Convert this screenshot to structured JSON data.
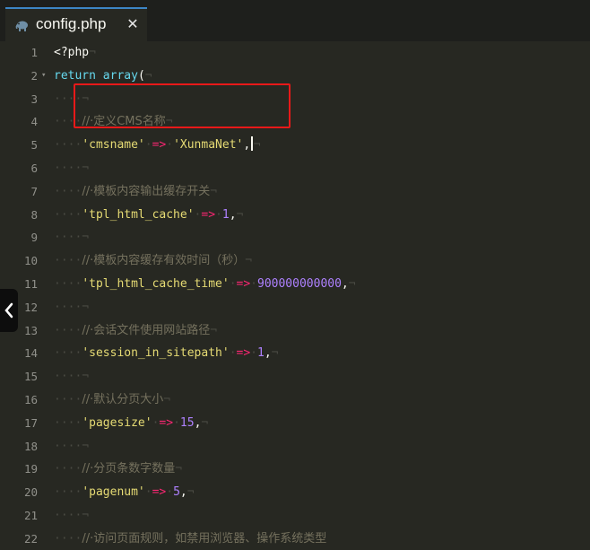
{
  "tab": {
    "title": "config.php",
    "close_glyph": "✕",
    "icon": "php-elephant-icon"
  },
  "editor": {
    "lines": [
      {
        "n": "1",
        "fold": "",
        "parts": [
          [
            "t",
            "<?php"
          ],
          [
            "ws",
            "¬"
          ]
        ]
      },
      {
        "n": "2",
        "fold": "▾",
        "parts": [
          [
            "kw",
            "return"
          ],
          [
            "t",
            " "
          ],
          [
            "kw",
            "array"
          ],
          [
            "t",
            "("
          ],
          [
            "ws",
            "¬"
          ]
        ]
      },
      {
        "n": "3",
        "fold": "",
        "parts": [
          [
            "ws",
            "····¬"
          ]
        ]
      },
      {
        "n": "4",
        "fold": "",
        "parts": [
          [
            "ws",
            "····"
          ],
          [
            "cm",
            "//·定义CMS名称"
          ],
          [
            "ws",
            "¬"
          ]
        ]
      },
      {
        "n": "5",
        "fold": "",
        "parts": [
          [
            "ws",
            "····"
          ],
          [
            "str",
            "'cmsname'"
          ],
          [
            "ws",
            "·"
          ],
          [
            "op",
            "=>"
          ],
          [
            "ws",
            "·"
          ],
          [
            "str",
            "'XunmaNet'"
          ],
          [
            "t",
            ","
          ],
          [
            "cursor",
            ""
          ],
          [
            "ws",
            "¬"
          ]
        ]
      },
      {
        "n": "6",
        "fold": "",
        "parts": [
          [
            "ws",
            "····¬"
          ]
        ]
      },
      {
        "n": "7",
        "fold": "",
        "parts": [
          [
            "ws",
            "····"
          ],
          [
            "cm",
            "//·模板内容输出缓存开关"
          ],
          [
            "ws",
            "¬"
          ]
        ]
      },
      {
        "n": "8",
        "fold": "",
        "parts": [
          [
            "ws",
            "····"
          ],
          [
            "str",
            "'tpl_html_cache'"
          ],
          [
            "ws",
            "·"
          ],
          [
            "op",
            "=>"
          ],
          [
            "ws",
            "·"
          ],
          [
            "num",
            "1"
          ],
          [
            "t",
            ","
          ],
          [
            "ws",
            "¬"
          ]
        ]
      },
      {
        "n": "9",
        "fold": "",
        "parts": [
          [
            "ws",
            "····¬"
          ]
        ]
      },
      {
        "n": "10",
        "fold": "",
        "parts": [
          [
            "ws",
            "····"
          ],
          [
            "cm",
            "//·模板内容缓存有效时间（秒）"
          ],
          [
            "ws",
            "¬"
          ]
        ]
      },
      {
        "n": "11",
        "fold": "",
        "parts": [
          [
            "ws",
            "····"
          ],
          [
            "str",
            "'tpl_html_cache_time'"
          ],
          [
            "ws",
            "·"
          ],
          [
            "op",
            "=>"
          ],
          [
            "ws",
            "·"
          ],
          [
            "num",
            "900000000000"
          ],
          [
            "t",
            ","
          ],
          [
            "ws",
            "¬"
          ]
        ]
      },
      {
        "n": "12",
        "fold": "",
        "parts": [
          [
            "ws",
            "····¬"
          ]
        ]
      },
      {
        "n": "13",
        "fold": "",
        "parts": [
          [
            "ws",
            "····"
          ],
          [
            "cm",
            "//·会话文件使用网站路径"
          ],
          [
            "ws",
            "¬"
          ]
        ]
      },
      {
        "n": "14",
        "fold": "",
        "parts": [
          [
            "ws",
            "····"
          ],
          [
            "str",
            "'session_in_sitepath'"
          ],
          [
            "ws",
            "·"
          ],
          [
            "op",
            "=>"
          ],
          [
            "ws",
            "·"
          ],
          [
            "num",
            "1"
          ],
          [
            "t",
            ","
          ],
          [
            "ws",
            "¬"
          ]
        ]
      },
      {
        "n": "15",
        "fold": "",
        "parts": [
          [
            "ws",
            "····¬"
          ]
        ]
      },
      {
        "n": "16",
        "fold": "",
        "parts": [
          [
            "ws",
            "····"
          ],
          [
            "cm",
            "//·默认分页大小"
          ],
          [
            "ws",
            "¬"
          ]
        ]
      },
      {
        "n": "17",
        "fold": "",
        "parts": [
          [
            "ws",
            "····"
          ],
          [
            "str",
            "'pagesize'"
          ],
          [
            "ws",
            "·"
          ],
          [
            "op",
            "=>"
          ],
          [
            "ws",
            "·"
          ],
          [
            "num",
            "15"
          ],
          [
            "t",
            ","
          ],
          [
            "ws",
            "¬"
          ]
        ]
      },
      {
        "n": "18",
        "fold": "",
        "parts": [
          [
            "ws",
            "····¬"
          ]
        ]
      },
      {
        "n": "19",
        "fold": "",
        "parts": [
          [
            "ws",
            "····"
          ],
          [
            "cm",
            "//·分页条数字数量"
          ],
          [
            "ws",
            "¬"
          ]
        ]
      },
      {
        "n": "20",
        "fold": "",
        "parts": [
          [
            "ws",
            "····"
          ],
          [
            "str",
            "'pagenum'"
          ],
          [
            "ws",
            "·"
          ],
          [
            "op",
            "=>"
          ],
          [
            "ws",
            "·"
          ],
          [
            "num",
            "5"
          ],
          [
            "t",
            ","
          ],
          [
            "ws",
            "¬"
          ]
        ]
      },
      {
        "n": "21",
        "fold": "",
        "parts": [
          [
            "ws",
            "····¬"
          ]
        ]
      },
      {
        "n": "22",
        "fold": "",
        "parts": [
          [
            "ws",
            "····"
          ],
          [
            "cm",
            "//·访问页面规则，如禁用浏览器、操作系统类型"
          ]
        ]
      }
    ]
  },
  "sidebar_toggle": {
    "icon": "chevron-left-icon"
  },
  "colors": {
    "background": "#272822",
    "tab_accent": "#3d86c6",
    "highlight_box": "#e81919",
    "string": "#e6db74",
    "keyword": "#66d9ef",
    "number": "#ae81ff",
    "operator": "#f92672",
    "comment": "#75715e"
  }
}
